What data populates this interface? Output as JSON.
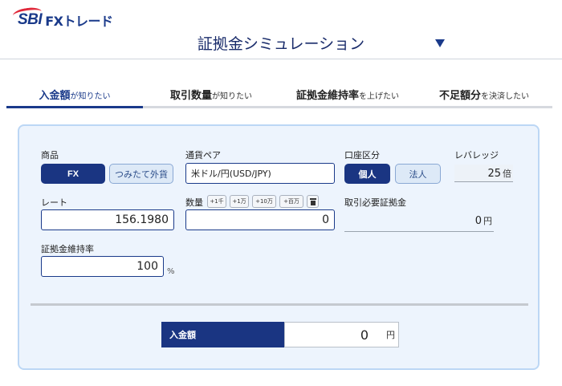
{
  "header": {
    "logo_sbi": "SBI",
    "logo_fx": "FXトレード",
    "title": "証拠金シミュレーション"
  },
  "tabs": [
    {
      "strong": "入金額",
      "small": "が知りたい",
      "active": true
    },
    {
      "strong": "取引数量",
      "small": "が知りたい",
      "active": false
    },
    {
      "strong": "証拠金維持率",
      "small": "を上げたい",
      "active": false
    },
    {
      "strong": "不足額分",
      "small": "を決済したい",
      "active": false
    }
  ],
  "form": {
    "product": {
      "label": "商品",
      "options": [
        "FX",
        "つみたて外貨"
      ],
      "selected": "FX"
    },
    "currency_pair": {
      "label": "通貨ペア",
      "value": "米ドル/円(USD/JPY)"
    },
    "account_type": {
      "label": "口座区分",
      "options": [
        "個人",
        "法人"
      ],
      "selected": "個人"
    },
    "leverage": {
      "label": "レバレッジ",
      "value": "25",
      "unit": "倍"
    },
    "rate": {
      "label": "レート",
      "value": "156.1980"
    },
    "quantity": {
      "label": "数量",
      "value": "0",
      "quick_buttons": [
        "+1千",
        "+1万",
        "+10万",
        "+百万"
      ]
    },
    "required_margin": {
      "label": "取引必要証拠金",
      "value": "0",
      "unit": "円"
    },
    "margin_ratio": {
      "label": "証拠金維持率",
      "value": "100",
      "unit": "%"
    }
  },
  "result": {
    "label": "入金額",
    "value": "0",
    "unit": "円"
  },
  "colors": {
    "primary": "#1a3582",
    "panel_bg": "#edf4fd",
    "panel_border": "#bcd7f5",
    "logo_red": "#e0283a"
  }
}
